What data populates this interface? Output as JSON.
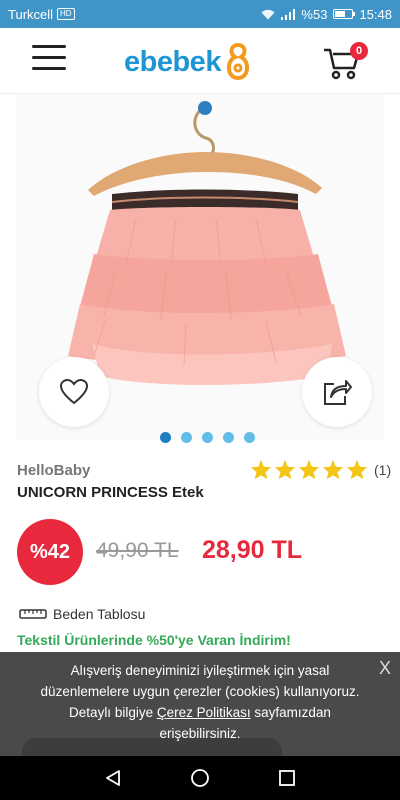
{
  "status_bar": {
    "carrier": "Turkcell",
    "network_badge": "HD",
    "battery": "%53",
    "time": "15:48"
  },
  "header": {
    "logo_text": "ebebek",
    "cart_count": "0"
  },
  "gallery": {
    "image_count": 5,
    "active_index": 0
  },
  "product": {
    "brand": "HelloBaby",
    "name": "UNICORN PRINCESS Etek",
    "rating_count": "(1)",
    "discount": "%42",
    "old_price": "49,90 TL",
    "new_price": "28,90 TL",
    "size_chart": "Beden Tablosu",
    "promo": "Tekstil Ürünlerinde %50'ye Varan İndirim!"
  },
  "cookie": {
    "text_before": "Alışveriş deneyiminizi iyileştirmek için yasal düzenlemelere uygun çerezler (cookies) kullanıyoruz. Detaylı bilgiye ",
    "link": "Çerez Politikası",
    "text_after": " sayfamızdan erişebilirsiniz.",
    "close": "X"
  },
  "colors": {
    "brand_blue": "#1e96d3",
    "logo_orange": "#f39a1e",
    "discount_red": "#e8283c",
    "star_yellow": "#f5c518",
    "promo_green": "#35a85a"
  }
}
